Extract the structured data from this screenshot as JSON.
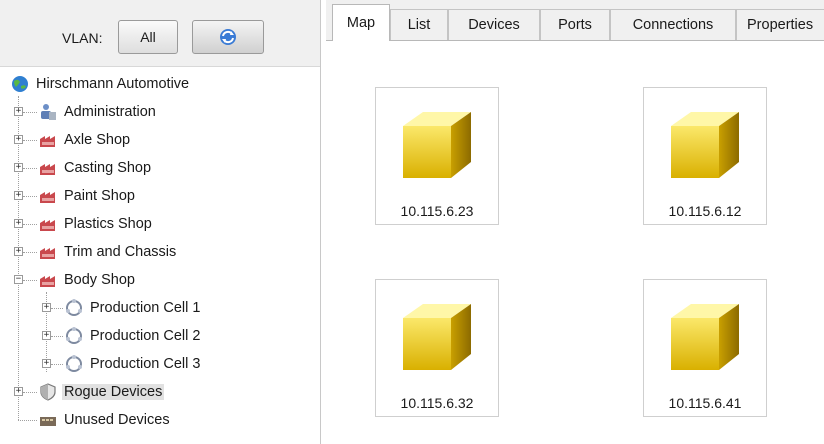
{
  "vlan": {
    "label": "VLAN:",
    "all_button": "All"
  },
  "tree": {
    "root": "Hirschmann Automotive",
    "items": [
      "Administration",
      "Axle Shop",
      "Casting Shop",
      "Paint Shop",
      "Plastics Shop",
      "Trim and Chassis",
      "Body Shop"
    ],
    "body_shop_children": [
      "Production Cell 1",
      "Production Cell 2",
      "Production Cell 3"
    ],
    "rogue": "Rogue Devices",
    "unused": "Unused Devices"
  },
  "tabs": [
    "Map",
    "List",
    "Devices",
    "Ports",
    "Connections",
    "Properties"
  ],
  "devices": [
    "10.115.6.23",
    "10.115.6.12",
    "10.115.6.32",
    "10.115.6.41"
  ],
  "icons": {
    "root": "globe-icon",
    "admin": "users-icon",
    "shop": "factory-icon",
    "cell": "ring-network-icon",
    "rogue": "shield-icon",
    "unused": "switch-device-icon",
    "refresh": "refresh-icon",
    "device": "yellow-cube-icon"
  }
}
